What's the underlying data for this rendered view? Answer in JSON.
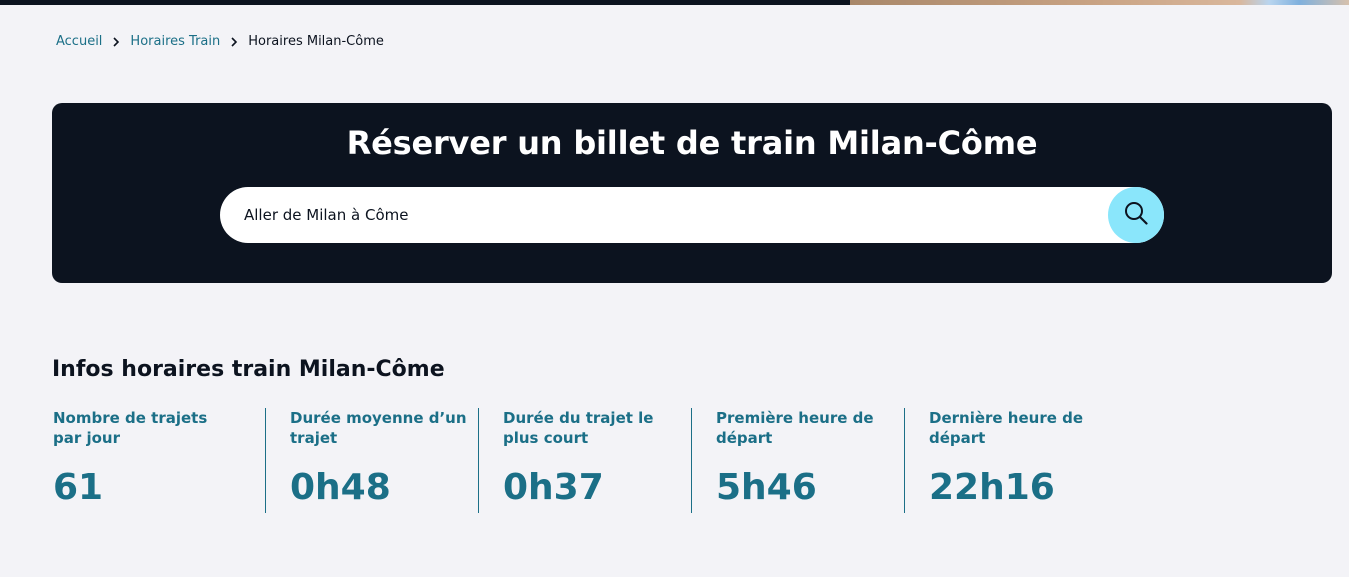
{
  "breadcrumb": {
    "home": "Accueil",
    "parent": "Horaires Train",
    "current": "Horaires Milan-Côme"
  },
  "booking": {
    "title": "Réserver un billet de train Milan-Côme",
    "search_value": "Aller de Milan à Côme",
    "search_icon": "search-icon"
  },
  "infos": {
    "title": "Infos horaires train Milan-Côme",
    "stats": [
      {
        "label": "Nombre de trajets par jour",
        "value": "61"
      },
      {
        "label": "Durée moyenne d’un trajet",
        "value": "0h48"
      },
      {
        "label": "Durée du trajet le plus court",
        "value": "0h37"
      },
      {
        "label": "Première heure de départ",
        "value": "5h46"
      },
      {
        "label": "Dernière heure de départ",
        "value": "22h16"
      }
    ]
  },
  "colors": {
    "dark": "#0c131f",
    "accent_teal": "#1b6f87",
    "search_button": "#8ae6fb",
    "background": "#f3f3f7"
  }
}
